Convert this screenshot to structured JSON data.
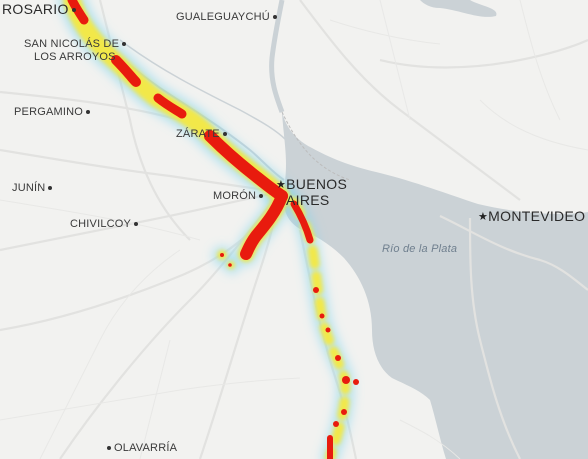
{
  "map": {
    "colors": {
      "land": "#f2f2f0",
      "water": "#cbd2d6",
      "road": "#ffffff",
      "road_outline": "#e0e0de"
    },
    "places": [
      {
        "id": "rosario",
        "name": "ROSARIO",
        "marker": "dot"
      },
      {
        "id": "gualeguaychu",
        "name": "GUALEGUAYCHÚ",
        "marker": "dot"
      },
      {
        "id": "san-nicolas",
        "name": "SAN NICOLÁS DE LOS ARROYOS",
        "line1": "SAN NICOLÁS DE",
        "line2": "LOS ARROYOS",
        "marker": "dot"
      },
      {
        "id": "pergamino",
        "name": "PERGAMINO",
        "marker": "dot"
      },
      {
        "id": "zarate",
        "name": "ZÁRATE",
        "marker": "dot"
      },
      {
        "id": "junin",
        "name": "JUNÍN",
        "marker": "dot"
      },
      {
        "id": "moron",
        "name": "MORÓN",
        "marker": "dot"
      },
      {
        "id": "buenos-aires",
        "name": "BUENOS AIRES",
        "line1": "BUENOS",
        "line2": "AIRES",
        "marker": "star"
      },
      {
        "id": "montevideo",
        "name": "MONTEVIDEO",
        "marker": "star"
      },
      {
        "id": "chivilcoy",
        "name": "CHIVILCOY",
        "marker": "dot"
      },
      {
        "id": "olavarria",
        "name": "OLAVARRÍA",
        "marker": "dot"
      }
    ],
    "water_labels": [
      {
        "id": "rio-de-la-plata",
        "name": "Río de la Plata"
      }
    ]
  }
}
